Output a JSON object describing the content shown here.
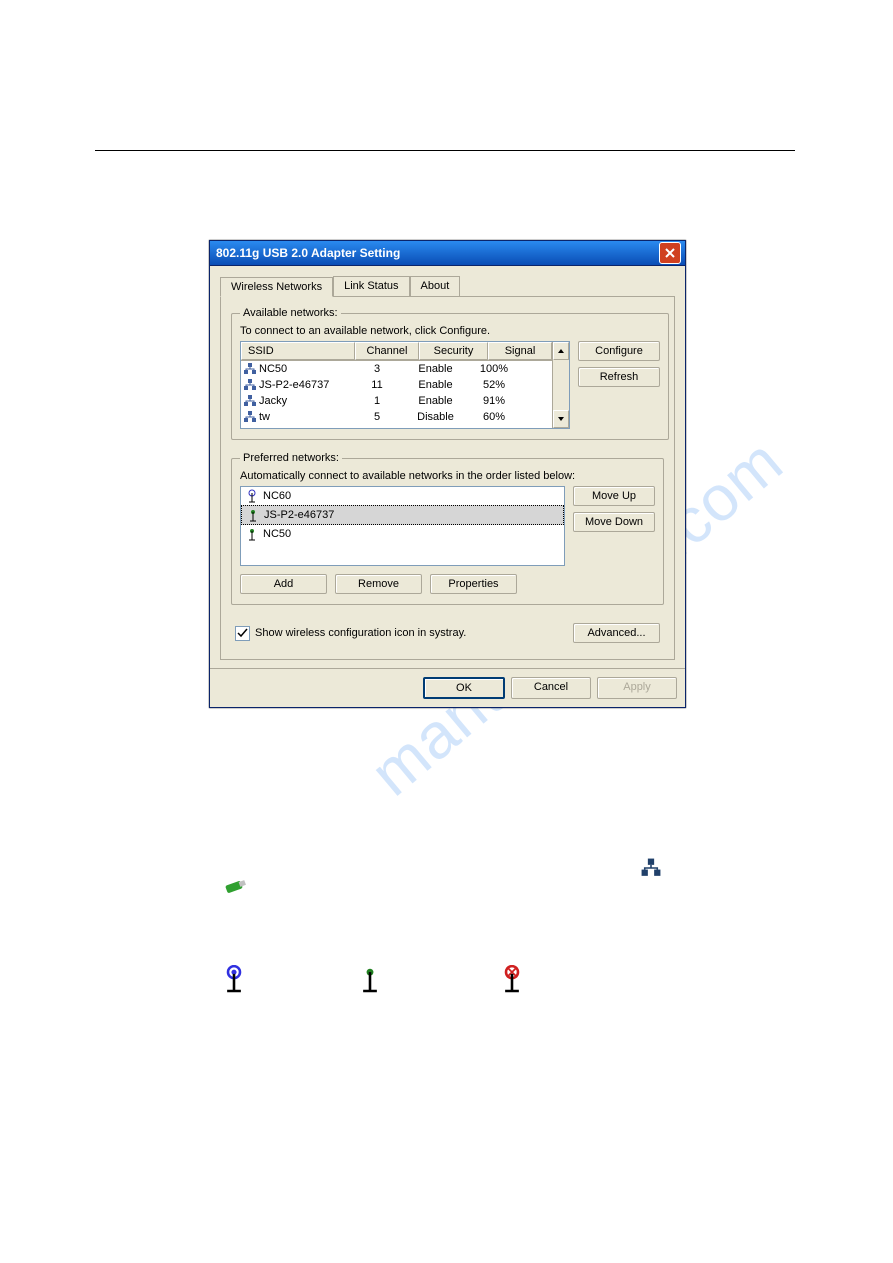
{
  "dialog_title": "802.11g USB 2.0 Adapter Setting",
  "tabs": {
    "wireless": "Wireless Networks",
    "link": "Link Status",
    "about": "About"
  },
  "available": {
    "legend": "Available networks:",
    "instruction": "To connect to an available network, click Configure.",
    "headers": {
      "ssid": "SSID",
      "channel": "Channel",
      "security": "Security",
      "signal": "Signal"
    },
    "rows": [
      {
        "ssid": "NC50",
        "channel": "3",
        "security": "Enable",
        "signal": "100%"
      },
      {
        "ssid": "JS-P2-e46737",
        "channel": "11",
        "security": "Enable",
        "signal": "52%"
      },
      {
        "ssid": "Jacky",
        "channel": "1",
        "security": "Enable",
        "signal": "91%"
      },
      {
        "ssid": "tw",
        "channel": "5",
        "security": "Disable",
        "signal": "60%"
      }
    ],
    "configure": "Configure",
    "refresh": "Refresh"
  },
  "preferred": {
    "legend": "Preferred networks:",
    "instruction": "Automatically connect to available networks in the order listed below:",
    "items": [
      {
        "name": "NC60",
        "selected": false,
        "icon": "antenna-blue"
      },
      {
        "name": "JS-P2-e46737",
        "selected": true,
        "icon": "antenna-green"
      },
      {
        "name": "NC50",
        "selected": false,
        "icon": "antenna-green"
      }
    ],
    "moveup": "Move Up",
    "movedown": "Move Down",
    "add": "Add",
    "remove": "Remove",
    "properties": "Properties"
  },
  "systray_label": "Show wireless configuration icon in systray.",
  "advanced": "Advanced...",
  "ok": "OK",
  "cancel": "Cancel",
  "apply": "Apply",
  "watermark": "manualshive.com"
}
